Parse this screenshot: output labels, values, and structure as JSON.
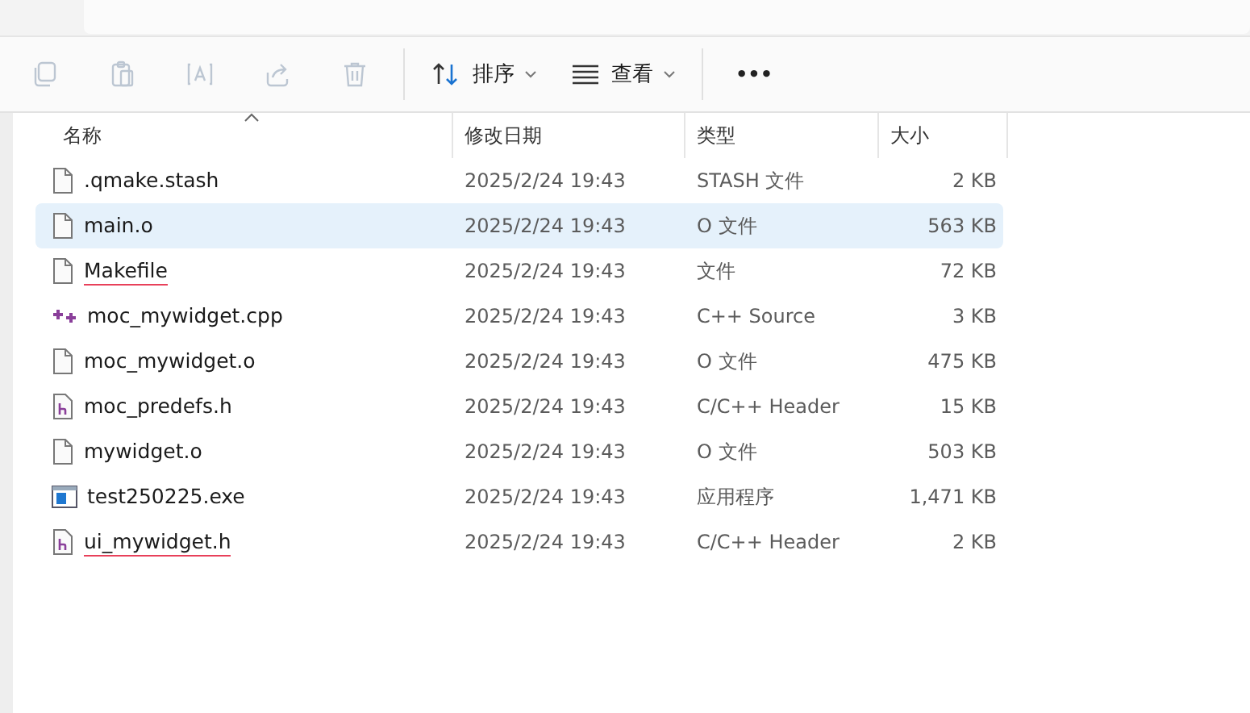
{
  "toolbar": {
    "buttons": [
      {
        "kind": "copy",
        "disabled": true
      },
      {
        "kind": "paste",
        "disabled": true
      },
      {
        "kind": "rename",
        "disabled": true
      },
      {
        "kind": "share",
        "disabled": true
      },
      {
        "kind": "delete",
        "disabled": true
      }
    ],
    "sort": "排序",
    "view": "查看",
    "more": "•••"
  },
  "table": {
    "columns": [
      "名称",
      "修改日期",
      "类型",
      "大小"
    ],
    "rows": [
      {
        "kind": "blank",
        "name": ".qmake.stash",
        "date": "2025/2/24 19:43",
        "type": "STASH 文件",
        "size": "2 KB",
        "selected": false,
        "underlined": false
      },
      {
        "kind": "blank",
        "name": "main.o",
        "date": "2025/2/24 19:43",
        "type": "O 文件",
        "size": "563 KB",
        "selected": true,
        "underlined": false
      },
      {
        "kind": "blank",
        "name": "Makefile",
        "date": "2025/2/24 19:43",
        "type": "文件",
        "size": "72 KB",
        "selected": false,
        "underlined": true
      },
      {
        "kind": "cpp",
        "name": "moc_mywidget.cpp",
        "date": "2025/2/24 19:43",
        "type": "C++ Source",
        "size": "3 KB",
        "selected": false,
        "underlined": false
      },
      {
        "kind": "blank",
        "name": "moc_mywidget.o",
        "date": "2025/2/24 19:43",
        "type": "O 文件",
        "size": "475 KB",
        "selected": false,
        "underlined": false
      },
      {
        "kind": "header",
        "name": "moc_predefs.h",
        "date": "2025/2/24 19:43",
        "type": "C/C++ Header",
        "size": "15 KB",
        "selected": false,
        "underlined": false
      },
      {
        "kind": "blank",
        "name": "mywidget.o",
        "date": "2025/2/24 19:43",
        "type": "O 文件",
        "size": "503 KB",
        "selected": false,
        "underlined": false
      },
      {
        "kind": "exe",
        "name": "test250225.exe",
        "date": "2025/2/24 19:43",
        "type": "应用程序",
        "size": "1,471 KB",
        "selected": false,
        "underlined": false
      },
      {
        "kind": "header",
        "name": "ui_mywidget.h",
        "date": "2025/2/24 19:43",
        "type": "C/C++ Header",
        "size": "2 KB",
        "selected": false,
        "underlined": true
      }
    ]
  }
}
